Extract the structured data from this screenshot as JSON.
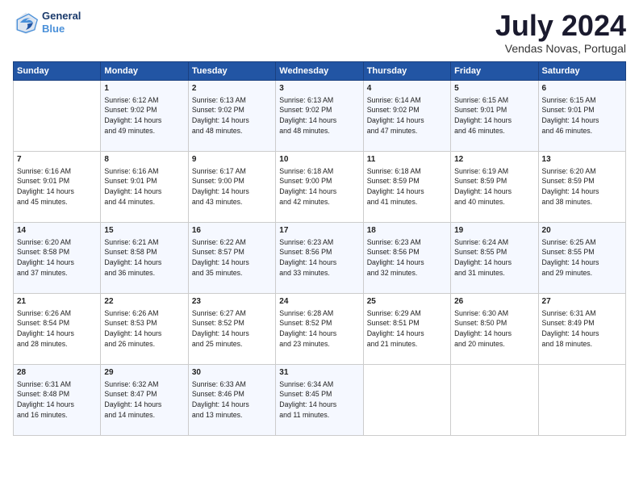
{
  "logo": {
    "line1": "General",
    "line2": "Blue"
  },
  "title": {
    "main": "July 2024",
    "sub": "Vendas Novas, Portugal"
  },
  "headers": [
    "Sunday",
    "Monday",
    "Tuesday",
    "Wednesday",
    "Thursday",
    "Friday",
    "Saturday"
  ],
  "weeks": [
    [
      {
        "day": "",
        "info": ""
      },
      {
        "day": "1",
        "info": "Sunrise: 6:12 AM\nSunset: 9:02 PM\nDaylight: 14 hours\nand 49 minutes."
      },
      {
        "day": "2",
        "info": "Sunrise: 6:13 AM\nSunset: 9:02 PM\nDaylight: 14 hours\nand 48 minutes."
      },
      {
        "day": "3",
        "info": "Sunrise: 6:13 AM\nSunset: 9:02 PM\nDaylight: 14 hours\nand 48 minutes."
      },
      {
        "day": "4",
        "info": "Sunrise: 6:14 AM\nSunset: 9:02 PM\nDaylight: 14 hours\nand 47 minutes."
      },
      {
        "day": "5",
        "info": "Sunrise: 6:15 AM\nSunset: 9:01 PM\nDaylight: 14 hours\nand 46 minutes."
      },
      {
        "day": "6",
        "info": "Sunrise: 6:15 AM\nSunset: 9:01 PM\nDaylight: 14 hours\nand 46 minutes."
      }
    ],
    [
      {
        "day": "7",
        "info": "Sunrise: 6:16 AM\nSunset: 9:01 PM\nDaylight: 14 hours\nand 45 minutes."
      },
      {
        "day": "8",
        "info": "Sunrise: 6:16 AM\nSunset: 9:01 PM\nDaylight: 14 hours\nand 44 minutes."
      },
      {
        "day": "9",
        "info": "Sunrise: 6:17 AM\nSunset: 9:00 PM\nDaylight: 14 hours\nand 43 minutes."
      },
      {
        "day": "10",
        "info": "Sunrise: 6:18 AM\nSunset: 9:00 PM\nDaylight: 14 hours\nand 42 minutes."
      },
      {
        "day": "11",
        "info": "Sunrise: 6:18 AM\nSunset: 8:59 PM\nDaylight: 14 hours\nand 41 minutes."
      },
      {
        "day": "12",
        "info": "Sunrise: 6:19 AM\nSunset: 8:59 PM\nDaylight: 14 hours\nand 40 minutes."
      },
      {
        "day": "13",
        "info": "Sunrise: 6:20 AM\nSunset: 8:59 PM\nDaylight: 14 hours\nand 38 minutes."
      }
    ],
    [
      {
        "day": "14",
        "info": "Sunrise: 6:20 AM\nSunset: 8:58 PM\nDaylight: 14 hours\nand 37 minutes."
      },
      {
        "day": "15",
        "info": "Sunrise: 6:21 AM\nSunset: 8:58 PM\nDaylight: 14 hours\nand 36 minutes."
      },
      {
        "day": "16",
        "info": "Sunrise: 6:22 AM\nSunset: 8:57 PM\nDaylight: 14 hours\nand 35 minutes."
      },
      {
        "day": "17",
        "info": "Sunrise: 6:23 AM\nSunset: 8:56 PM\nDaylight: 14 hours\nand 33 minutes."
      },
      {
        "day": "18",
        "info": "Sunrise: 6:23 AM\nSunset: 8:56 PM\nDaylight: 14 hours\nand 32 minutes."
      },
      {
        "day": "19",
        "info": "Sunrise: 6:24 AM\nSunset: 8:55 PM\nDaylight: 14 hours\nand 31 minutes."
      },
      {
        "day": "20",
        "info": "Sunrise: 6:25 AM\nSunset: 8:55 PM\nDaylight: 14 hours\nand 29 minutes."
      }
    ],
    [
      {
        "day": "21",
        "info": "Sunrise: 6:26 AM\nSunset: 8:54 PM\nDaylight: 14 hours\nand 28 minutes."
      },
      {
        "day": "22",
        "info": "Sunrise: 6:26 AM\nSunset: 8:53 PM\nDaylight: 14 hours\nand 26 minutes."
      },
      {
        "day": "23",
        "info": "Sunrise: 6:27 AM\nSunset: 8:52 PM\nDaylight: 14 hours\nand 25 minutes."
      },
      {
        "day": "24",
        "info": "Sunrise: 6:28 AM\nSunset: 8:52 PM\nDaylight: 14 hours\nand 23 minutes."
      },
      {
        "day": "25",
        "info": "Sunrise: 6:29 AM\nSunset: 8:51 PM\nDaylight: 14 hours\nand 21 minutes."
      },
      {
        "day": "26",
        "info": "Sunrise: 6:30 AM\nSunset: 8:50 PM\nDaylight: 14 hours\nand 20 minutes."
      },
      {
        "day": "27",
        "info": "Sunrise: 6:31 AM\nSunset: 8:49 PM\nDaylight: 14 hours\nand 18 minutes."
      }
    ],
    [
      {
        "day": "28",
        "info": "Sunrise: 6:31 AM\nSunset: 8:48 PM\nDaylight: 14 hours\nand 16 minutes."
      },
      {
        "day": "29",
        "info": "Sunrise: 6:32 AM\nSunset: 8:47 PM\nDaylight: 14 hours\nand 14 minutes."
      },
      {
        "day": "30",
        "info": "Sunrise: 6:33 AM\nSunset: 8:46 PM\nDaylight: 14 hours\nand 13 minutes."
      },
      {
        "day": "31",
        "info": "Sunrise: 6:34 AM\nSunset: 8:45 PM\nDaylight: 14 hours\nand 11 minutes."
      },
      {
        "day": "",
        "info": ""
      },
      {
        "day": "",
        "info": ""
      },
      {
        "day": "",
        "info": ""
      }
    ]
  ]
}
